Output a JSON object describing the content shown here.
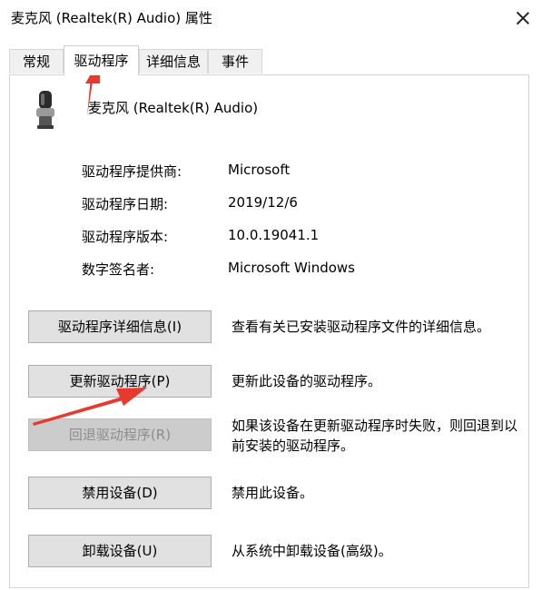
{
  "window": {
    "title": "麦克风 (Realtek(R) Audio) 属性"
  },
  "tabs": [
    {
      "label": "常规"
    },
    {
      "label": "驱动程序"
    },
    {
      "label": "详细信息"
    },
    {
      "label": "事件"
    }
  ],
  "device": {
    "name": "麦克风 (Realtek(R) Audio)",
    "icon": "microphone-icon"
  },
  "info": [
    {
      "label": "驱动程序提供商:",
      "value": "Microsoft"
    },
    {
      "label": "驱动程序日期:",
      "value": "2019/12/6"
    },
    {
      "label": "驱动程序版本:",
      "value": "10.0.19041.1"
    },
    {
      "label": "数字签名者:",
      "value": "Microsoft Windows"
    }
  ],
  "actions": [
    {
      "button": "驱动程序详细信息(I)",
      "desc": "查看有关已安装驱动程序文件的详细信息。",
      "enabled": true
    },
    {
      "button": "更新驱动程序(P)",
      "desc": "更新此设备的驱动程序。",
      "enabled": true
    },
    {
      "button": "回退驱动程序(R)",
      "desc": "如果该设备在更新驱动程序时失败，则回退到以前安装的驱动程序。",
      "enabled": false
    },
    {
      "button": "禁用设备(D)",
      "desc": "禁用此设备。",
      "enabled": true
    },
    {
      "button": "卸载设备(U)",
      "desc": "从系统中卸载设备(高级)。",
      "enabled": true
    }
  ],
  "colors": {
    "annotation_arrow": "#e8392e"
  }
}
